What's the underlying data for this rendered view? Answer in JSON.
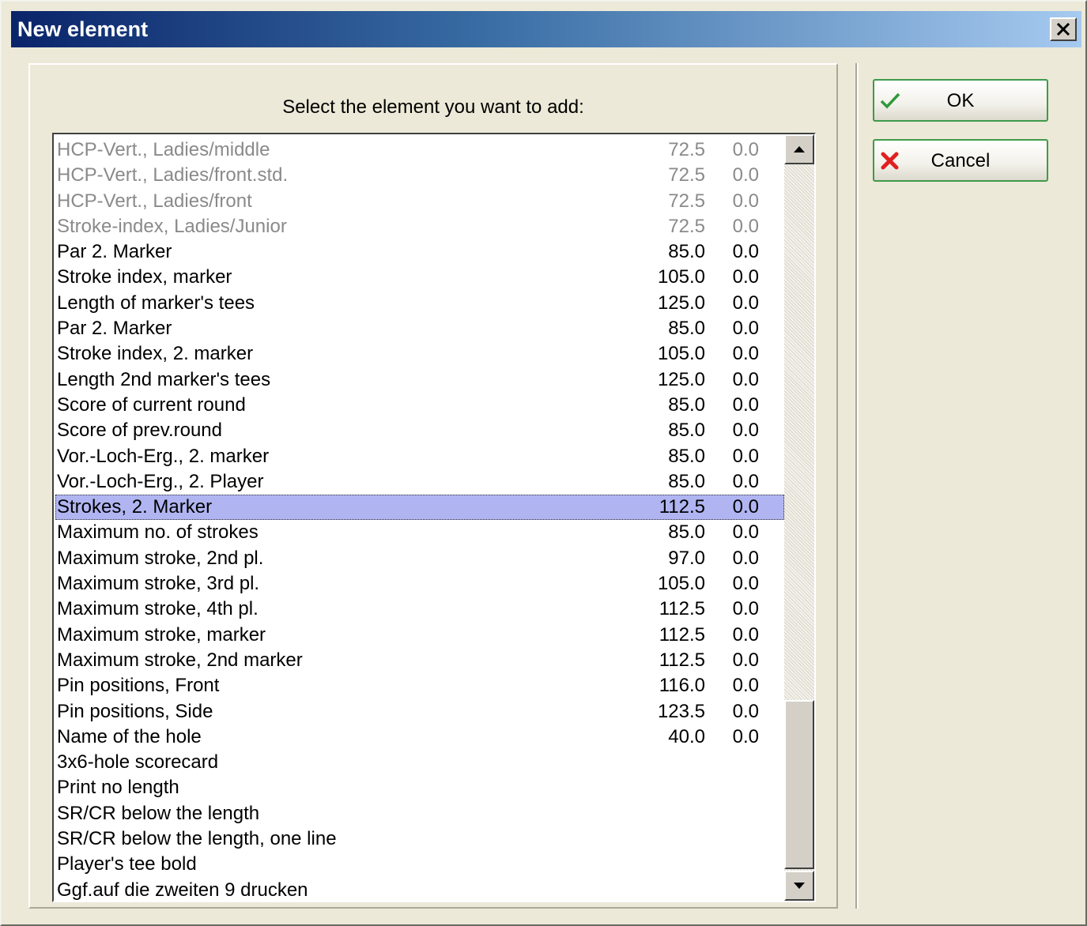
{
  "window": {
    "title": "New element"
  },
  "dialog": {
    "prompt": "Select the element you want to add:",
    "ok_label": "OK",
    "cancel_label": "Cancel"
  },
  "colors": {
    "title_gradient_start": "#0a246a",
    "title_gradient_end": "#a6caf0",
    "selection": "#b0b5f2",
    "dim_text": "#8a8a8a",
    "button_border": "#3e9a4a"
  },
  "icons": {
    "close": "close-icon",
    "ok": "checkmark-icon",
    "cancel": "red-x-icon",
    "scroll_up": "arrow-up-icon",
    "scroll_down": "arrow-down-icon"
  },
  "elements": [
    {
      "name": "HCP-Vert., Ladies/middle",
      "v1": "72.5",
      "v2": "0.0",
      "dim": true
    },
    {
      "name": "HCP-Vert., Ladies/front.std.",
      "v1": "72.5",
      "v2": "0.0",
      "dim": true
    },
    {
      "name": "HCP-Vert., Ladies/front",
      "v1": "72.5",
      "v2": "0.0",
      "dim": true
    },
    {
      "name": "Stroke-index, Ladies/Junior",
      "v1": "72.5",
      "v2": "0.0",
      "dim": true
    },
    {
      "name": "Par 2. Marker",
      "v1": "85.0",
      "v2": "0.0"
    },
    {
      "name": "Stroke index, marker",
      "v1": "105.0",
      "v2": "0.0"
    },
    {
      "name": "Length of marker's tees",
      "v1": "125.0",
      "v2": "0.0"
    },
    {
      "name": "Par 2. Marker",
      "v1": "85.0",
      "v2": "0.0"
    },
    {
      "name": "Stroke index, 2. marker",
      "v1": "105.0",
      "v2": "0.0"
    },
    {
      "name": "Length 2nd marker's tees",
      "v1": "125.0",
      "v2": "0.0"
    },
    {
      "name": "Score of current round",
      "v1": "85.0",
      "v2": "0.0"
    },
    {
      "name": "Score of prev.round",
      "v1": "85.0",
      "v2": "0.0"
    },
    {
      "name": "Vor.-Loch-Erg., 2. marker",
      "v1": "85.0",
      "v2": "0.0"
    },
    {
      "name": "Vor.-Loch-Erg., 2. Player",
      "v1": "85.0",
      "v2": "0.0"
    },
    {
      "name": "Strokes, 2. Marker",
      "v1": "112.5",
      "v2": "0.0",
      "selected": true
    },
    {
      "name": "Maximum no. of strokes",
      "v1": "85.0",
      "v2": "0.0"
    },
    {
      "name": "Maximum stroke, 2nd pl.",
      "v1": "97.0",
      "v2": "0.0"
    },
    {
      "name": "Maximum stroke, 3rd pl.",
      "v1": "105.0",
      "v2": "0.0"
    },
    {
      "name": "Maximum stroke, 4th pl.",
      "v1": "112.5",
      "v2": "0.0"
    },
    {
      "name": "Maximum stroke, marker",
      "v1": "112.5",
      "v2": "0.0"
    },
    {
      "name": "Maximum stroke, 2nd marker",
      "v1": "112.5",
      "v2": "0.0"
    },
    {
      "name": "Pin positions, Front",
      "v1": "116.0",
      "v2": "0.0"
    },
    {
      "name": "Pin positions, Side",
      "v1": "123.5",
      "v2": "0.0"
    },
    {
      "name": "Name of the hole",
      "v1": "40.0",
      "v2": "0.0"
    },
    {
      "name": "3x6-hole scorecard",
      "v1": "",
      "v2": ""
    },
    {
      "name": "Print no length",
      "v1": "",
      "v2": ""
    },
    {
      "name": "SR/CR below the length",
      "v1": "",
      "v2": ""
    },
    {
      "name": "SR/CR below the length, one line",
      "v1": "",
      "v2": ""
    },
    {
      "name": "Player's tee bold",
      "v1": "",
      "v2": ""
    },
    {
      "name": "Ggf.auf die zweiten 9 drucken",
      "v1": "",
      "v2": ""
    }
  ]
}
